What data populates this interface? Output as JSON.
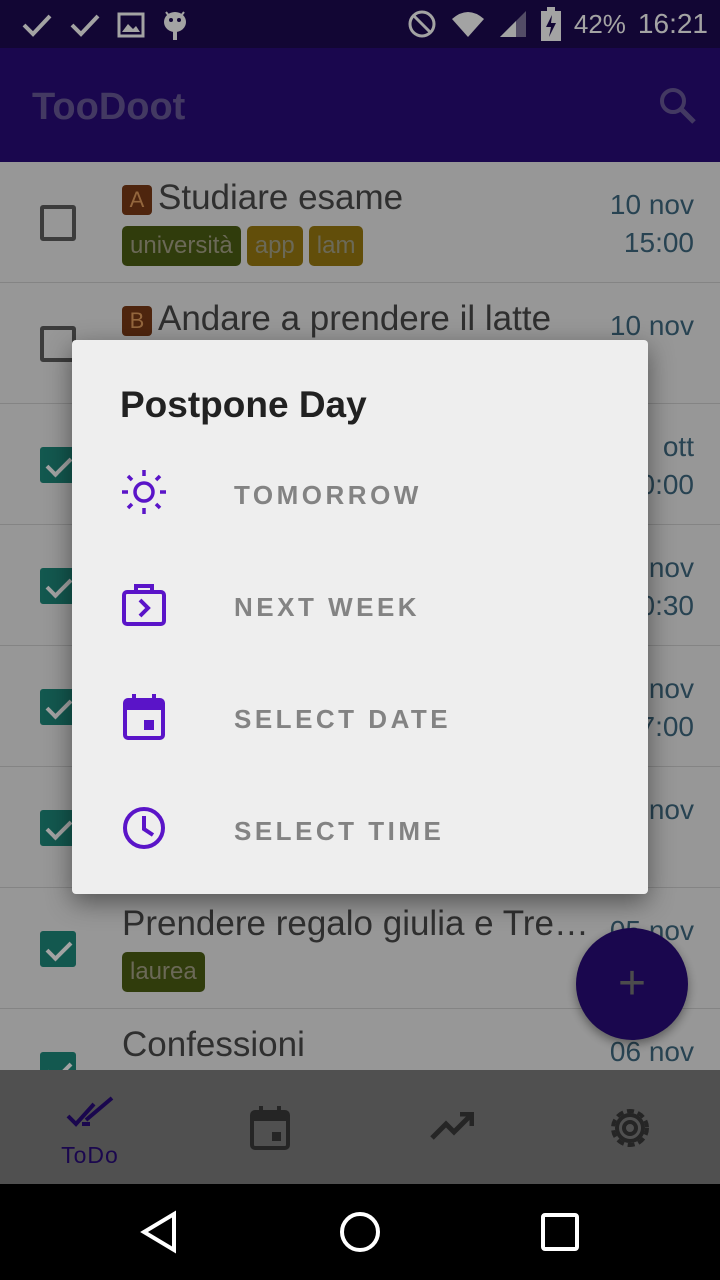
{
  "status_bar": {
    "battery": "42%",
    "time": "16:21",
    "icons": [
      "check-icon",
      "check-icon",
      "image-icon",
      "android-icon",
      "do-not-disturb-icon",
      "wifi-icon",
      "signal-icon",
      "battery-charging-icon"
    ]
  },
  "app_bar": {
    "title": "TooDoot",
    "search_icon": "search-icon"
  },
  "list": {
    "items": [
      {
        "priority": "A",
        "title": "Studiare esame",
        "tags": [
          "università",
          "app",
          "lam"
        ],
        "date": "10 nov",
        "time": "15:00",
        "checked": false
      },
      {
        "priority": "B",
        "title": "Andare a prendere il latte",
        "tags": [],
        "date": "10 nov",
        "time": "",
        "checked": false
      },
      {
        "priority": "",
        "title": "",
        "tags": [],
        "date": "ott",
        "time": "0:00",
        "checked": true
      },
      {
        "priority": "",
        "title": "",
        "tags": [],
        "date": "nov",
        "time": "0:30",
        "checked": true
      },
      {
        "priority": "",
        "title": "",
        "tags": [],
        "date": "nov",
        "time": "7:00",
        "checked": true
      },
      {
        "priority": "",
        "title": "",
        "tags": [],
        "date": "nov",
        "time": "",
        "checked": true
      },
      {
        "priority": "",
        "title": "Prendere regalo giulia e Tre…",
        "tags": [
          "laurea"
        ],
        "date": "05 nov",
        "time": "",
        "checked": true
      },
      {
        "priority": "",
        "title": "Confessioni",
        "tags": [],
        "date": "06 nov",
        "time": "",
        "checked": true
      }
    ]
  },
  "dialog": {
    "title": "Postpone Day",
    "options": [
      {
        "label": "TOMORROW",
        "icon": "sun-icon"
      },
      {
        "label": "NEXT WEEK",
        "icon": "next-week-icon"
      },
      {
        "label": "SELECT DATE",
        "icon": "calendar-icon"
      },
      {
        "label": "SELECT TIME",
        "icon": "clock-icon"
      }
    ]
  },
  "fab": {
    "label": "+"
  },
  "bottom_nav": {
    "items": [
      {
        "label": "ToDo",
        "icon": "double-check-icon",
        "active": true
      },
      {
        "label": "",
        "icon": "calendar-icon",
        "active": false
      },
      {
        "label": "",
        "icon": "trending-up-icon",
        "active": false
      },
      {
        "label": "",
        "icon": "gear-icon",
        "active": false
      }
    ]
  },
  "colors": {
    "primary": "#2a0c7a",
    "accent_icon": "#5a14c8",
    "checkbox_checked": "#1f8a7c",
    "date_text": "#3f6a80",
    "tag_universita": "#4b5e14",
    "tag_app": "#9a7a10",
    "tag_lam": "#9a7a10",
    "tag_laurea": "#4b5e14",
    "priority_a": "#7a3a16",
    "priority_b": "#7a3a16"
  }
}
